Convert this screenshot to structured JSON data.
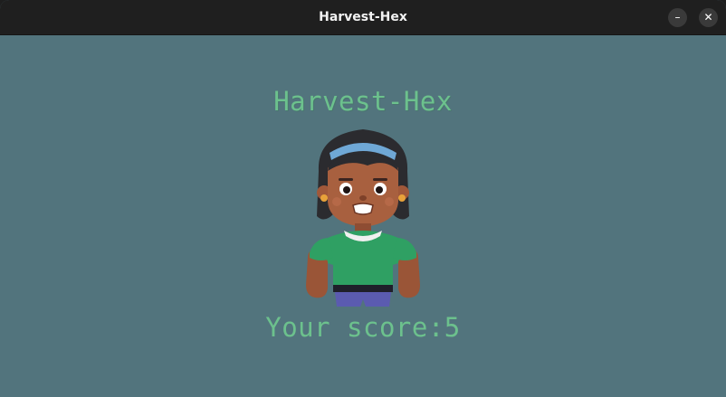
{
  "window": {
    "title": "Harvest-Hex",
    "minimize_glyph": "–",
    "close_glyph": "✕"
  },
  "game": {
    "title": "Harvest-Hex",
    "score_label": "Your score:",
    "score_value": "5",
    "character_icon": "player-character-girl",
    "colors": {
      "background": "#52747d",
      "text": "#6cc18d"
    }
  }
}
